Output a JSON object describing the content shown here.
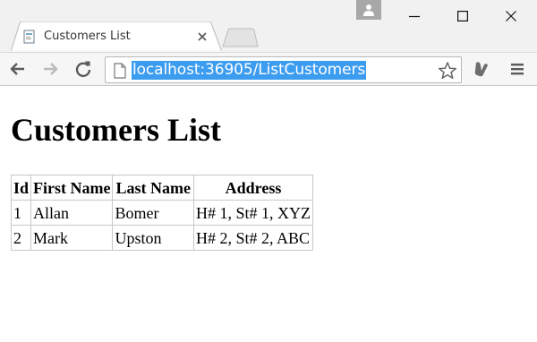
{
  "tab": {
    "title": "Customers List"
  },
  "address_bar": {
    "url": "localhost:36905/ListCustomers"
  },
  "page": {
    "title": "Customers List",
    "table": {
      "headers": [
        "Id",
        "First Name",
        "Last Name",
        "Address"
      ],
      "rows": [
        [
          "1",
          "Allan",
          "Bomer",
          "H# 1, St# 1, XYZ"
        ],
        [
          "2",
          "Mark",
          "Upston",
          "H# 2, St# 2, ABC"
        ]
      ]
    }
  },
  "colors": {
    "url_selection": "#3c9cf0",
    "titlebar": "#f1f1f1",
    "toolbar": "#f6f6f6"
  },
  "icons": {
    "favicon": "page-favicon-icon",
    "tab_close": "close-icon",
    "profile": "user-icon",
    "minimize": "minimize-icon",
    "maximize": "maximize-icon",
    "window_close": "close-icon",
    "back": "arrow-left-icon",
    "forward": "arrow-right-icon",
    "reload": "reload-icon",
    "page_info": "page-icon",
    "bookmark": "star-icon",
    "extension": "extension-icon",
    "menu": "menu-icon"
  }
}
